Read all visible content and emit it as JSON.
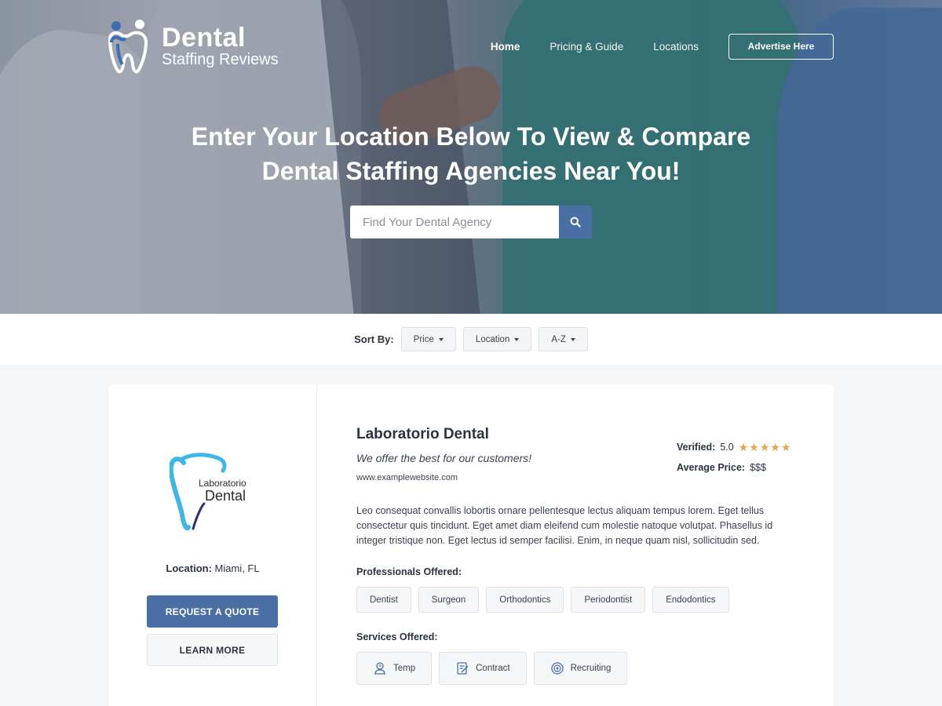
{
  "brand": {
    "line1": "Dental",
    "line2": "Staffing Reviews",
    "accent": "#4a6fa5"
  },
  "nav": {
    "items": [
      "Home",
      "Pricing & Guide",
      "Locations"
    ],
    "cta": "Advertise Here"
  },
  "hero": {
    "headline_light": "Enter Your Location Below To ",
    "headline_bold_1": "View & Compare",
    "headline_bold_2": "Dental Staffing Agencies Near You!",
    "search_placeholder": "Find Your Dental Agency",
    "search_icon": "search-icon"
  },
  "sort": {
    "label": "Sort By:",
    "options": [
      "Price",
      "Location",
      "A-Z"
    ]
  },
  "listing": {
    "logo_text_1": "Laboratorio",
    "logo_text_2": "Dental",
    "location_label": "Location:",
    "location_value": "Miami, FL",
    "quote_button": "REQUEST A QUOTE",
    "learn_button": "LEARN MORE",
    "name": "Laboratorio Dental",
    "tagline": "We offer the best for our customers!",
    "url": "www.examplewebsite.com",
    "verified_label": "Verified:",
    "rating": "5.0",
    "rating_stars": 5,
    "price_label": "Average Price:",
    "price_value": "$$$",
    "description": "Leo consequat convallis lobortis ornare pellentesque lectus aliquam tempus lorem. Eget tellus consectetur quis tincidunt. Eget amet diam eleifend cum molestie natoque volutpat. Phasellus id integer tristique non. Eget lectus id semper facilisi. Enim, in neque quam nisl, sollicitudin sed.",
    "professionals_title": "Professionals Offered:",
    "professionals": [
      "Dentist",
      "Surgeon",
      "Orthodontics",
      "Periodontist",
      "Endodontics"
    ],
    "services_title": "Services Offered:",
    "services": [
      {
        "label": "Temp",
        "icon": "clock-person-icon"
      },
      {
        "label": "Contract",
        "icon": "contract-icon"
      },
      {
        "label": "Recruiting",
        "icon": "target-icon"
      }
    ],
    "star_color": "#e7a44d"
  }
}
